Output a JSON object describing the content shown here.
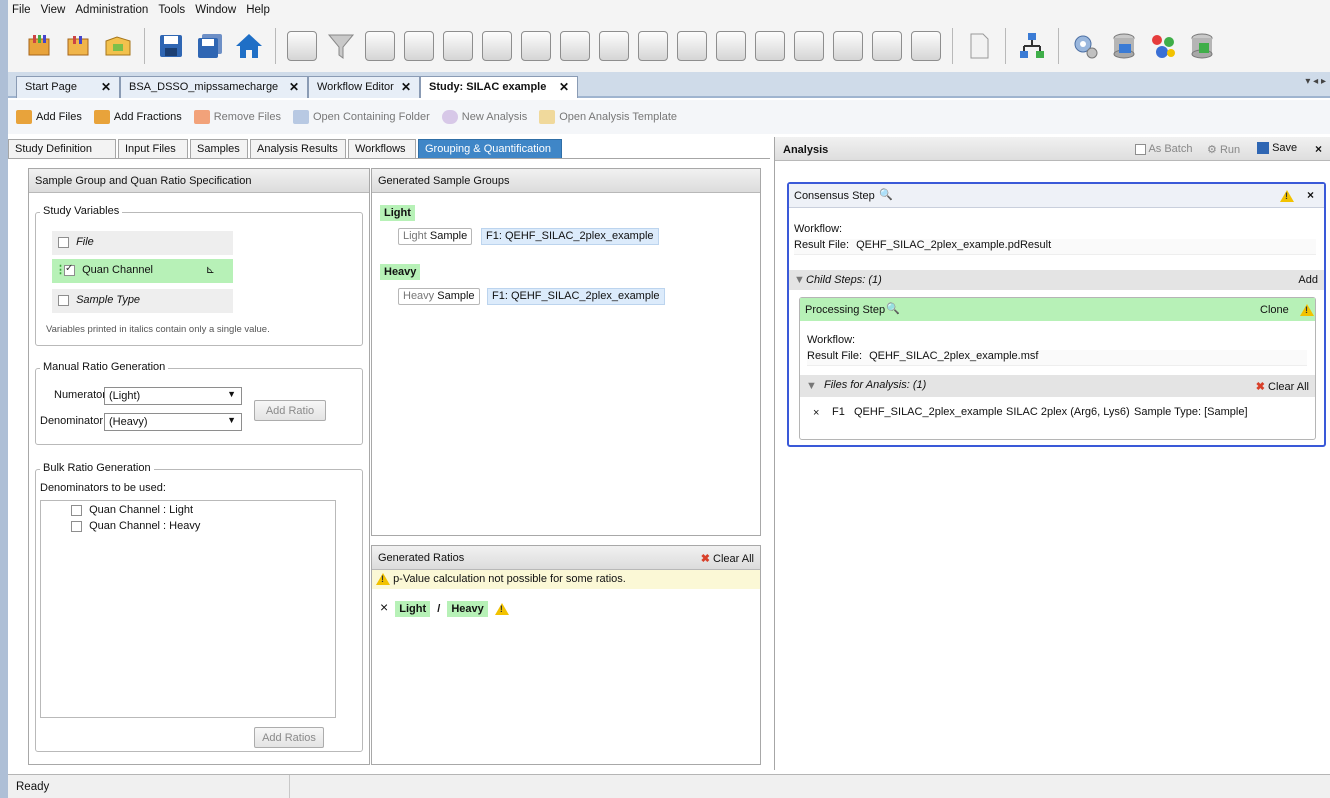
{
  "menu": [
    "File",
    "View",
    "Administration",
    "Tools",
    "Window",
    "Help"
  ],
  "toolbar": {
    "icons": [
      "new-study-icon",
      "open-study-icon",
      "open-result-icon",
      "save-icon",
      "save-all-icon",
      "home-icon",
      "grid-icon",
      "filter-icon",
      "chart-icon-1",
      "chart-icon-2",
      "chart-icon-3",
      "view-icon",
      "spectrum-icon",
      "bar-chart-icon-1",
      "bar-chart-icon-2",
      "table-icon",
      "bar-chart-icon-3",
      "bar-chart-icon-4",
      "list-icon",
      "grid-icon-2",
      "compare-icon",
      "bar-chart-icon-5",
      "bar-chart-icon-6",
      "document-icon",
      "workflow-tree-icon",
      "settings-icon",
      "database-icon",
      "molecule-icon",
      "database-export-icon"
    ]
  },
  "doc_tabs": [
    {
      "label": "Start Page",
      "active": false
    },
    {
      "label": "BSA_DSSO_mipssamecharge",
      "active": false
    },
    {
      "label": "Workflow Editor",
      "active": false
    },
    {
      "label": "Study: SILAC example",
      "active": true
    }
  ],
  "tabs_menu": "▾ ◂ ▸",
  "study_toolbar": {
    "add_files": "Add Files",
    "add_fractions": "Add Fractions",
    "remove_files": "Remove Files",
    "open_folder": "Open Containing Folder",
    "new_analysis": "New Analysis",
    "open_template": "Open Analysis Template"
  },
  "inner_tabs": [
    "Study Definition",
    "Input Files",
    "Samples",
    "Analysis Results",
    "Workflows",
    "Grouping & Quantification"
  ],
  "spec_panel": {
    "title": "Sample Group and Quan Ratio Specification",
    "study_variables_title": "Study Variables",
    "variables": [
      {
        "label": "File",
        "checked": false,
        "italic": true
      },
      {
        "label": "Quan Channel",
        "checked": true,
        "italic": false
      },
      {
        "label": "Sample Type",
        "checked": false,
        "italic": true
      }
    ],
    "variables_note": "Variables printed in italics contain only a single value.",
    "manual_title": "Manual Ratio Generation",
    "numerator_label": "Numerator:",
    "numerator_value": "(Light)",
    "denominator_label": "Denominator:",
    "denominator_value": "(Heavy)",
    "add_ratio": "Add Ratio",
    "bulk_title": "Bulk Ratio Generation",
    "denominators_label": "Denominators to be used:",
    "denominators": [
      "Quan Channel : Light",
      "Quan Channel : Heavy"
    ],
    "add_ratios": "Add Ratios"
  },
  "groups_panel": {
    "title": "Generated Sample Groups",
    "groups": [
      {
        "name": "Light",
        "tag": "Light",
        "type": "Sample",
        "file": "F1: QEHF_SILAC_2plex_example"
      },
      {
        "name": "Heavy",
        "tag": "Heavy",
        "type": "Sample",
        "file": "F1: QEHF_SILAC_2plex_example"
      }
    ]
  },
  "ratios_panel": {
    "title": "Generated Ratios",
    "clear_all": "Clear All",
    "warning": "p-Value calculation not possible for some ratios.",
    "ratio": {
      "remove": "×",
      "numerator": "Light",
      "slash": "/",
      "denominator": "Heavy"
    }
  },
  "analysis": {
    "title": "Analysis",
    "as_batch": "As Batch",
    "run": "Run",
    "save": "Save",
    "close": "×",
    "consensus": {
      "title": "Consensus Step",
      "workflow_label": "Workflow:",
      "result_label": "Result File:",
      "result_value": "QEHF_SILAC_2plex_example.pdResult",
      "child_steps": "Child Steps: (1)",
      "add": "Add"
    },
    "processing": {
      "title": "Processing Step",
      "clone": "Clone",
      "workflow_label": "Workflow:",
      "result_label": "Result File:",
      "result_value": "QEHF_SILAC_2plex_example.msf",
      "files_for_analysis": "Files for Analysis: (1)",
      "clear_all": "Clear All",
      "file_row": {
        "remove": "×",
        "id": "F1",
        "name": "QEHF_SILAC_2plex_example",
        "method": "SILAC 2plex (Arg6, Lys6)",
        "sample_type": "Sample Type: [Sample]"
      }
    }
  },
  "status": "Ready"
}
